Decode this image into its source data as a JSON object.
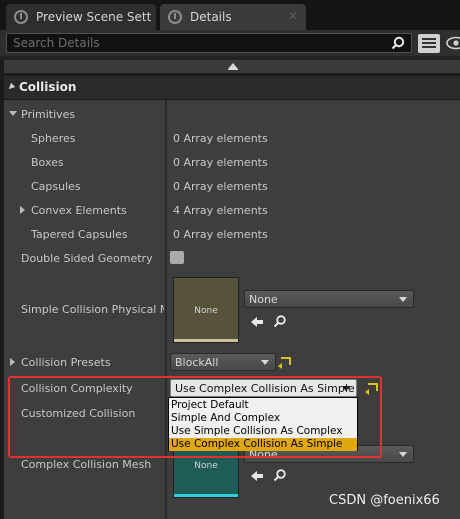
{
  "tabs": [
    {
      "label": "Preview Scene Sett",
      "icon": "info-icon"
    },
    {
      "label": "Details",
      "icon": "info-icon"
    }
  ],
  "search": {
    "placeholder": "Search Details"
  },
  "category": {
    "label": "Collision"
  },
  "primitives": {
    "label": "Primitives",
    "items": [
      {
        "name": "Spheres",
        "value": "0 Array elements"
      },
      {
        "name": "Boxes",
        "value": "0 Array elements"
      },
      {
        "name": "Capsules",
        "value": "0 Array elements"
      },
      {
        "name": "Convex Elements",
        "value": "4 Array elements"
      },
      {
        "name": "Tapered Capsules",
        "value": "0 Array elements"
      }
    ]
  },
  "double_sided": {
    "label": "Double Sided Geometry",
    "checked": false
  },
  "simple_phys_mat": {
    "label": "Simple Collision Physical Ma",
    "thumb_label": "None",
    "combo_value": "None"
  },
  "presets": {
    "label": "Collision Presets",
    "value": "BlockAll"
  },
  "complexity": {
    "label": "Collision Complexity",
    "value": "Use Complex Collision As Simple",
    "options": [
      "Project Default",
      "Simple And Complex",
      "Use Simple Collision As Complex",
      "Use Complex Collision As Simple"
    ],
    "selected_index": 3
  },
  "customized": {
    "label": "Customized Collision"
  },
  "complex_mesh": {
    "label": "Complex Collision Mesh",
    "thumb_label": "None",
    "combo_value": "None"
  },
  "watermark": "CSDN @foenix66",
  "colors": {
    "highlight": "#e1a70f",
    "annotation_box": "#e53030",
    "reset_arrow": "#d9c31a"
  }
}
